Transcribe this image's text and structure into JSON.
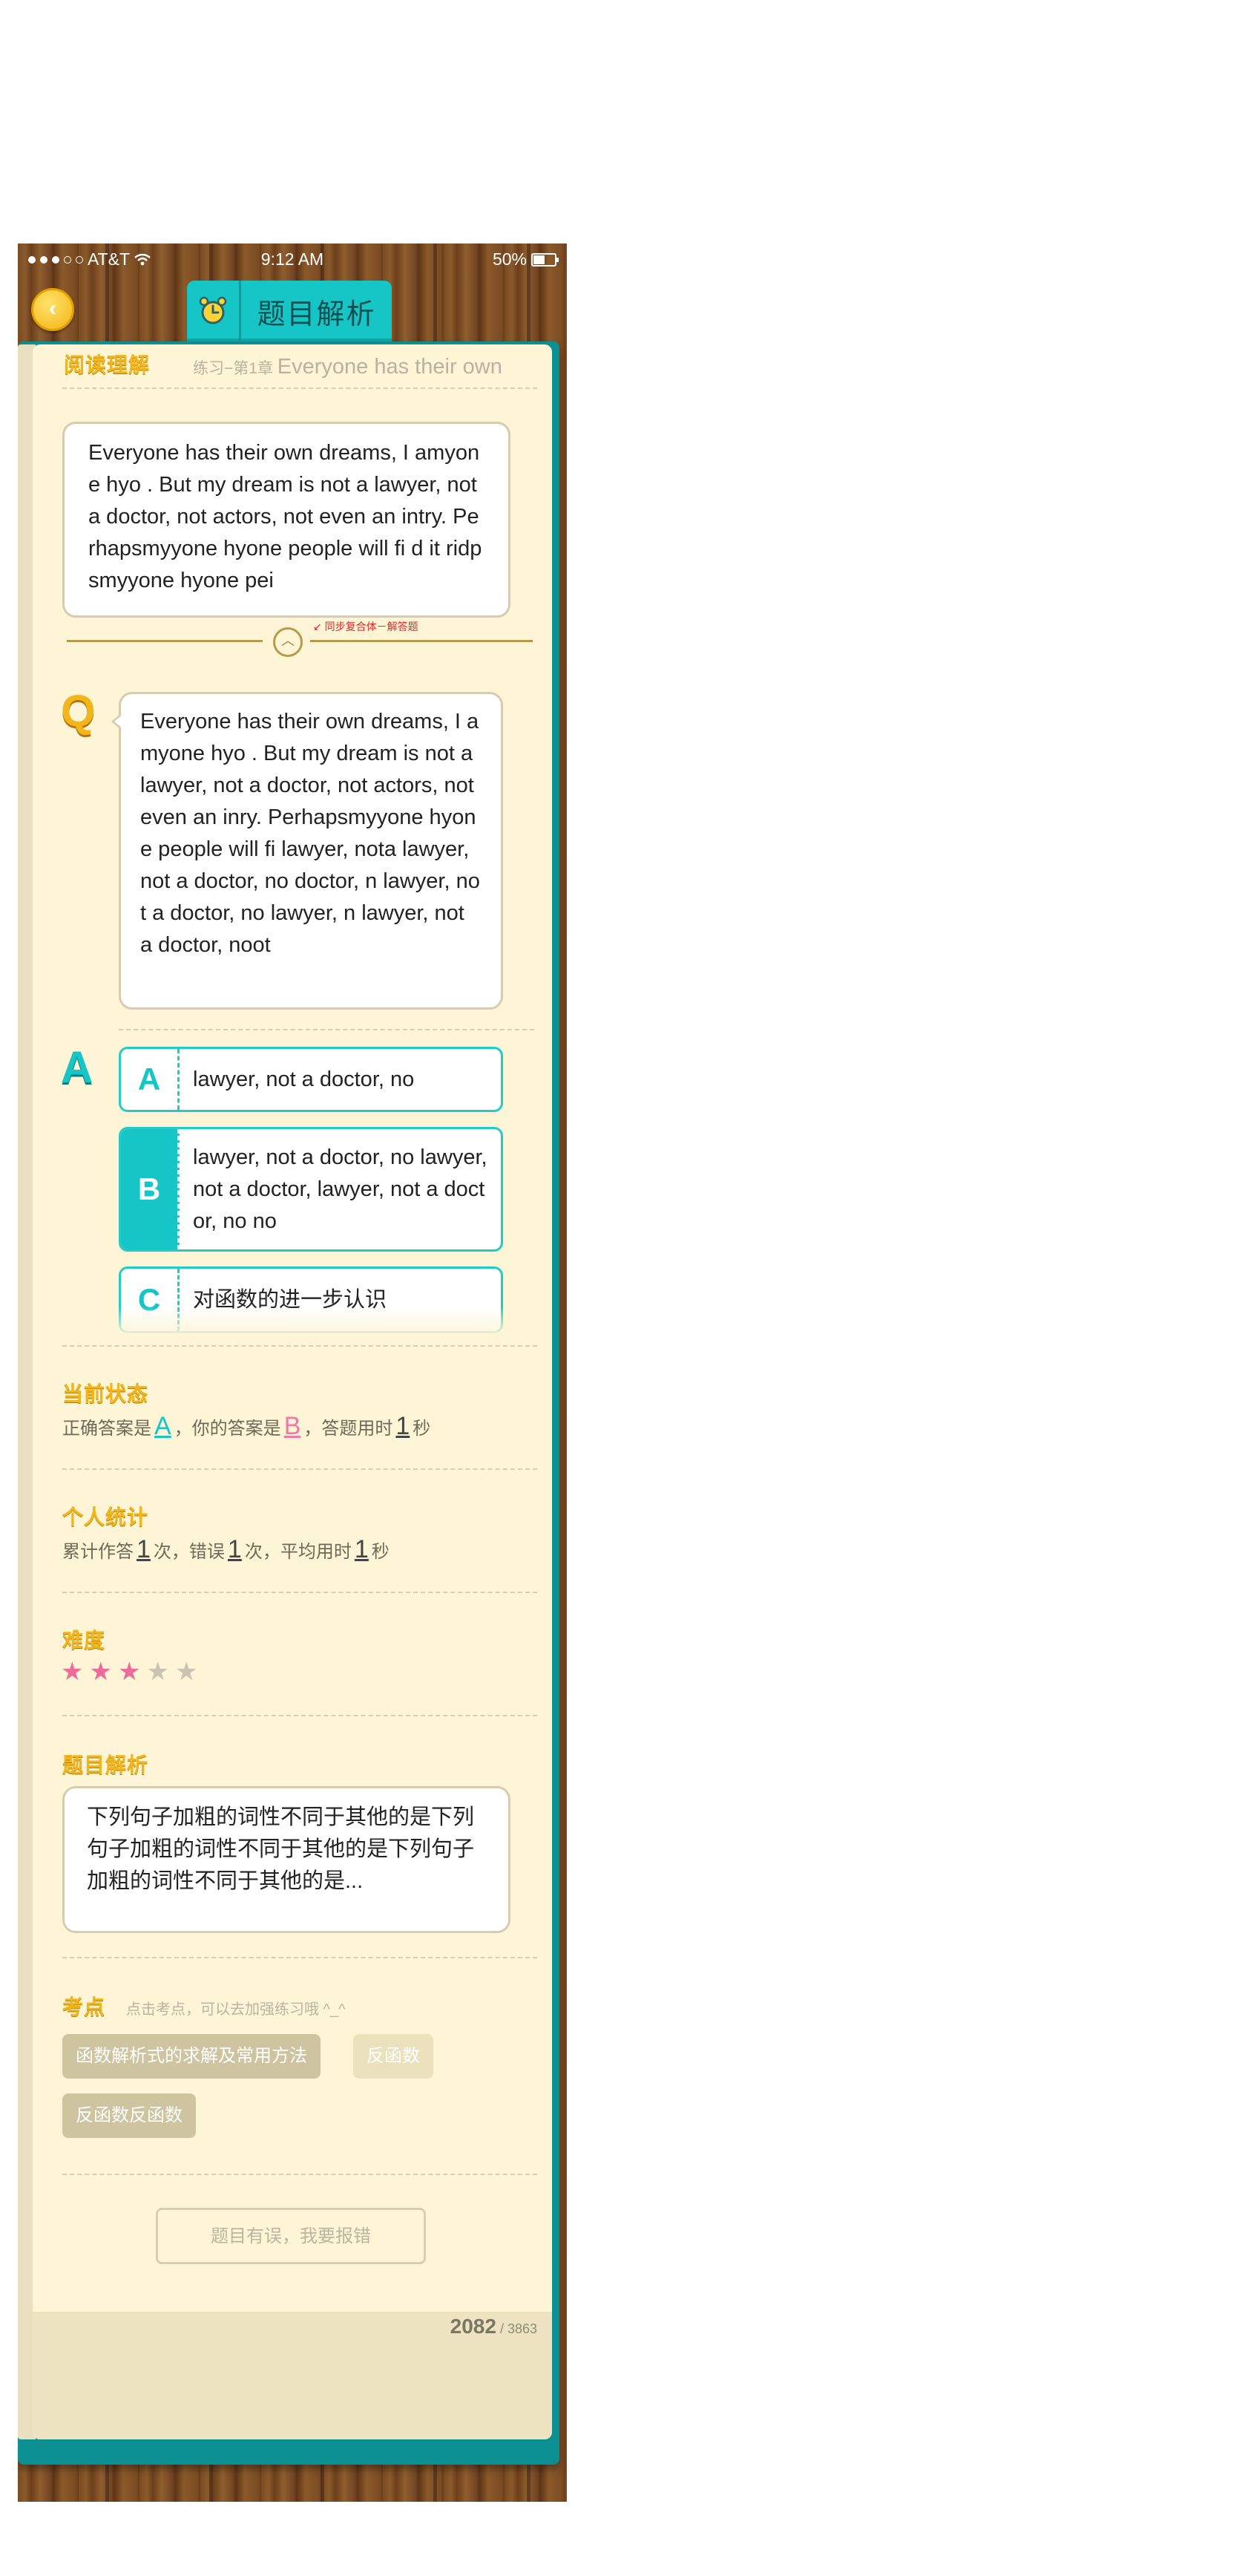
{
  "status_bar": {
    "carrier": "AT&T",
    "time": "9:12 AM",
    "battery": "50%"
  },
  "header": {
    "title": "题目解析",
    "back_icon": "chevron-left-icon",
    "alarm_icon": "alarm-clock-icon"
  },
  "section_reading": {
    "title": "阅读理解",
    "breadcrumb_cn": "练习−第1章",
    "breadcrumb_en": "Everyone has their own",
    "passage": "Everyone has their own dreams, I amyone hyo . But my dream is not a lawyer, not a doctor, not actors, not even an intry. Perhapsmyyone hyone people will fi d it ridpsmyyone hyone pei",
    "collapse_note": "同步复合体－解答题"
  },
  "question": {
    "label": "Q",
    "text": "Everyone has their own dreams, I amyone hyo . But my dream is not a lawyer, not a doctor, not actors, not even an inry. Perhapsmyyone hyone people will fi lawyer, nota lawyer, not a doctor, no doctor, n lawyer, not a doctor, no lawyer, n lawyer, not a doctor, noot"
  },
  "answer": {
    "label": "A",
    "options": [
      {
        "letter": "A",
        "text": "lawyer, not a doctor, no"
      },
      {
        "letter": "B",
        "text": "lawyer, not a doctor, no lawyer, not a doctor, lawyer, not a doctor, no no"
      },
      {
        "letter": "C",
        "text": "对函数的进一步认识"
      }
    ],
    "selected": "B"
  },
  "status_section": {
    "title": "当前状态",
    "p1": "正确答案是",
    "correct": "A",
    "p2": "，你的答案是",
    "yours": "B",
    "p3": "，答题用时",
    "seconds": "1",
    "p4": "秒"
  },
  "stats_section": {
    "title": "个人统计",
    "p1": "累计作答",
    "total": "1",
    "p2": "次，错误",
    "wrong": "1",
    "p3": "次，平均用时",
    "avg": "1",
    "p4": "秒"
  },
  "difficulty": {
    "title": "难度",
    "stars": 3,
    "max": 5
  },
  "analysis": {
    "title": "题目解析",
    "text": "下列句子加粗的词性不同于其他的是下列句子加粗的词性不同于其他的是下列句子加粗的词性不同于其他的是..."
  },
  "points": {
    "title": "考点",
    "hint": "点击考点，可以去加强练习哦 ^_^",
    "tags": [
      "函数解析式的求解及常用方法",
      "反函数",
      "反函数反函数"
    ]
  },
  "report_button": "题目有误，我要报错",
  "page": {
    "current": "2082",
    "total": "3863"
  },
  "colors": {
    "accent": "#16c6c7",
    "gold": "#f2b51b",
    "pink": "#f06b9b",
    "paper": "#fdf5d6"
  }
}
